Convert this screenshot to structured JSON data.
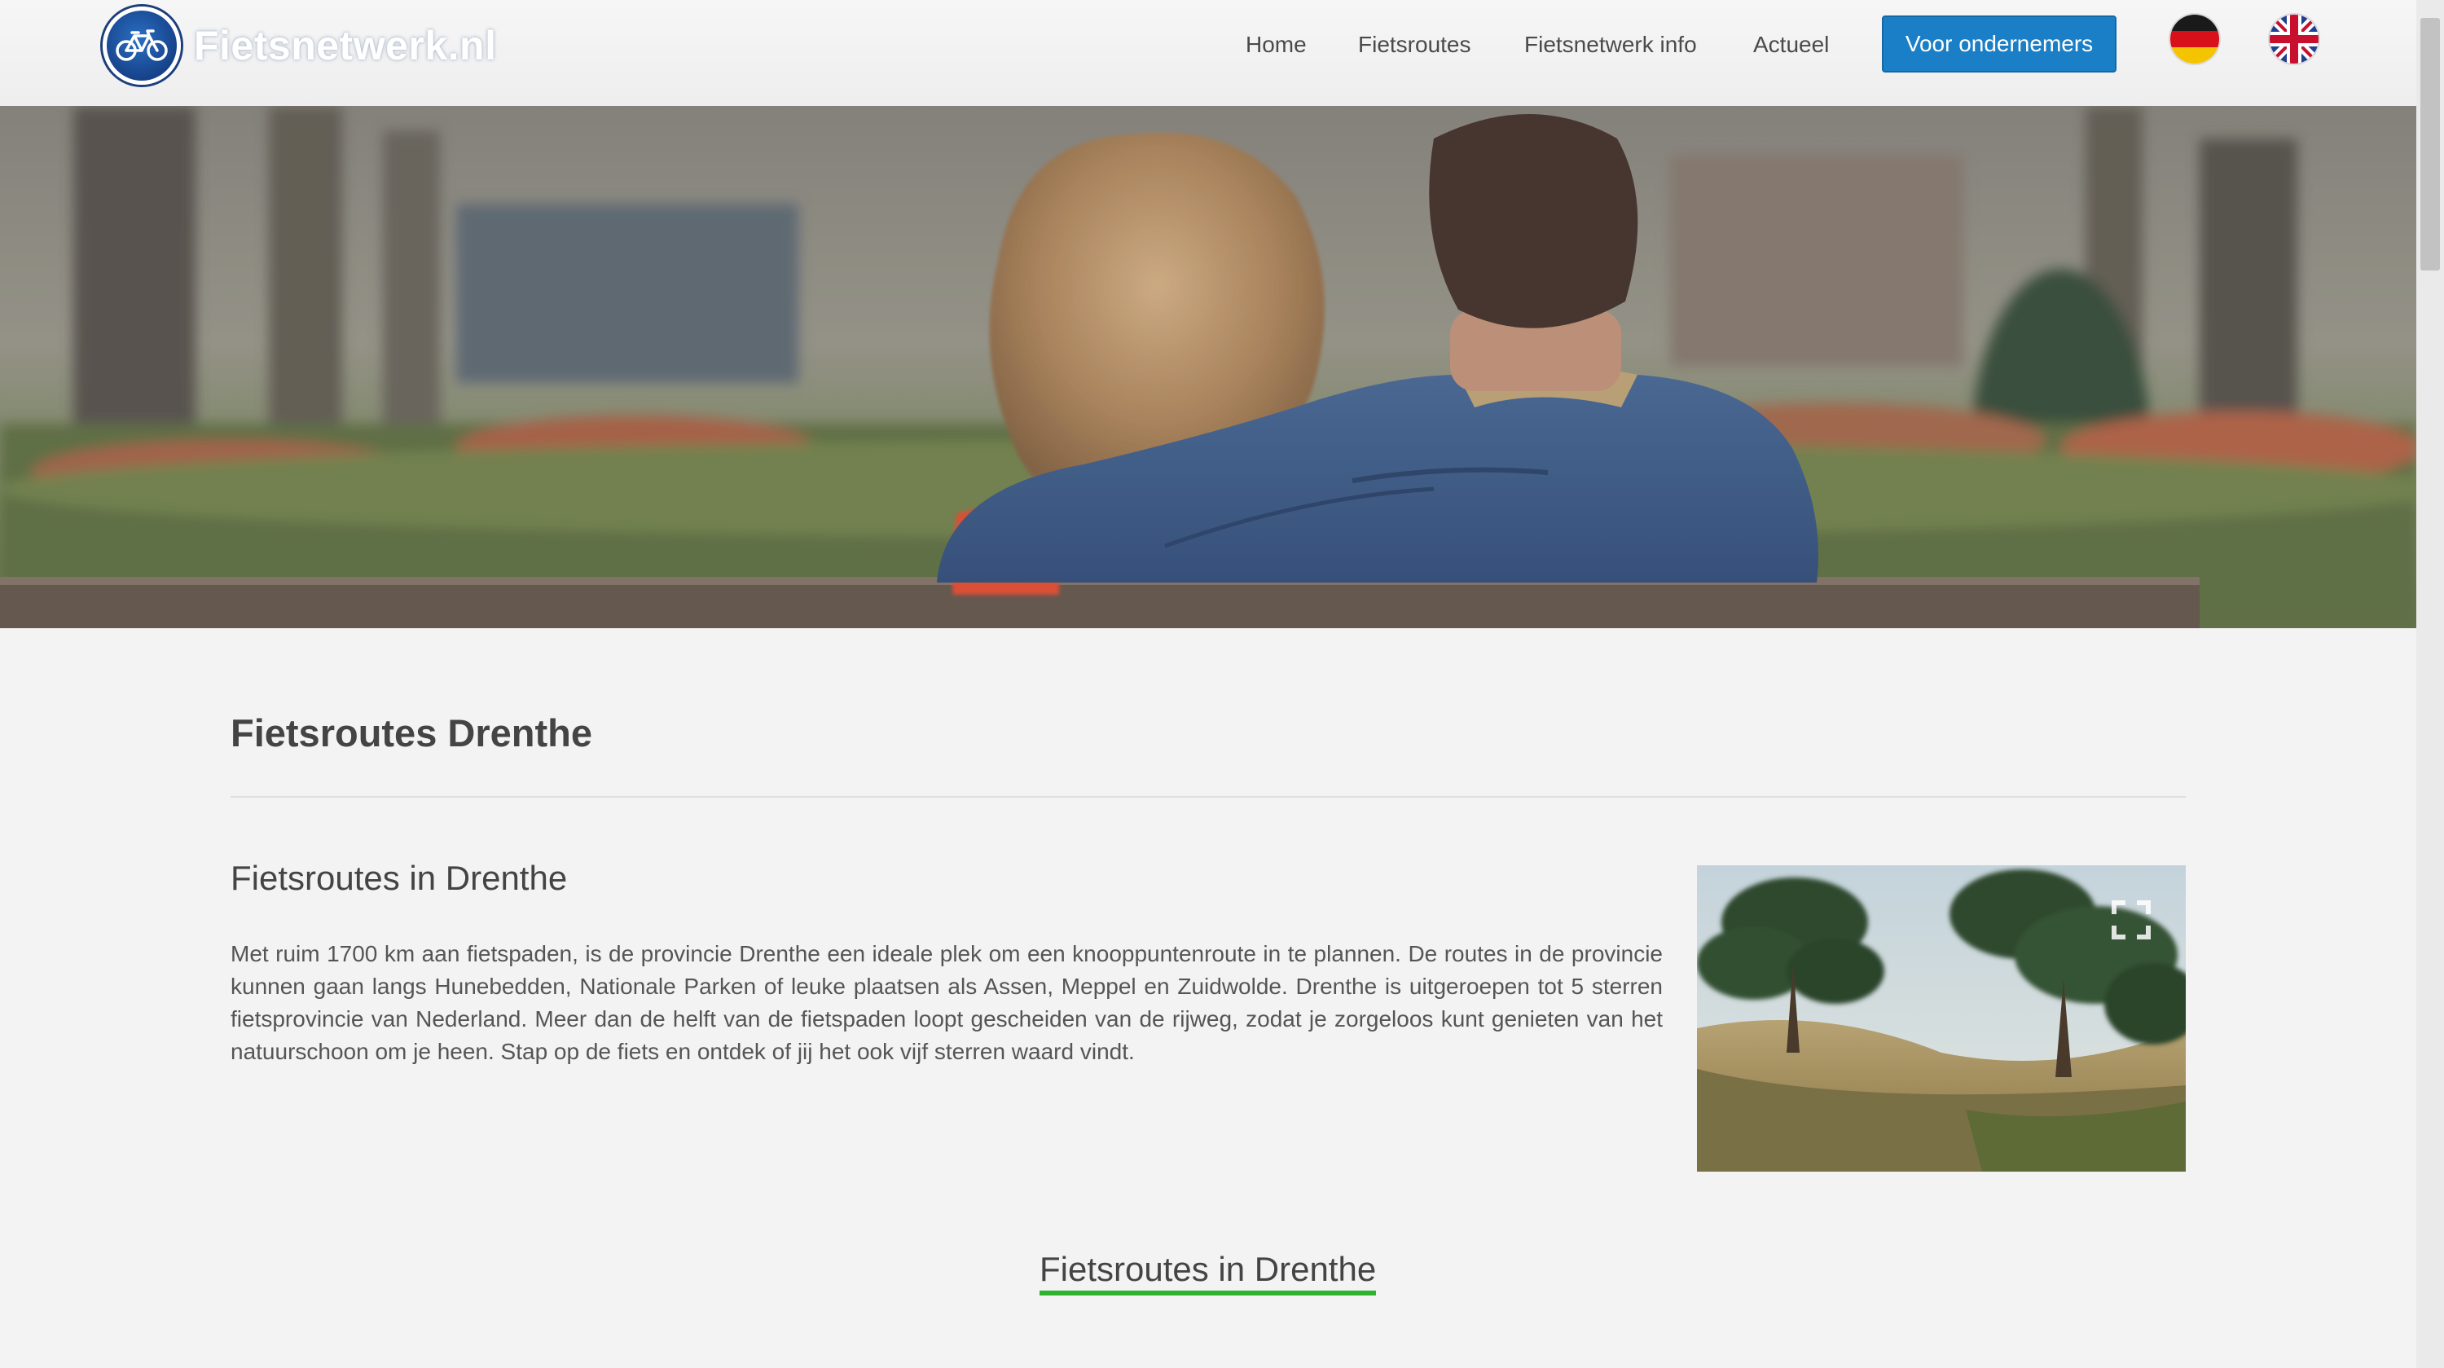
{
  "brand": {
    "logo_text": "Fietsnetwerk.nl"
  },
  "nav": {
    "items": [
      "Home",
      "Fietsroutes",
      "Fietsnetwerk info",
      "Actueel"
    ],
    "cta_label": "Voor ondernemers"
  },
  "languages": [
    "german-flag-icon",
    "uk-flag-icon"
  ],
  "page": {
    "title": "Fietsroutes Drenthe",
    "subtitle": "Fietsroutes in Drenthe",
    "intro": "Met ruim 1700 km aan fietspaden, is de provincie Drenthe een ideale plek om een knooppuntenroute in te plannen. De routes in de provincie kunnen gaan langs Hunebedden, Nationale Parken of leuke plaatsen als Assen, Meppel en Zuidwolde. Drenthe is uitgeroepen tot 5 sterren fietsprovincie van Nederland. Meer dan de helft van de fietspaden loopt gescheiden van de rijweg, zodat je zorgeloos kunt genieten van het natuurschoon om je heen. Stap op de fiets en ontdek of jij het ook vijf sterren waard vindt.",
    "section_heading": "Fietsroutes in Drenthe"
  },
  "colors": {
    "cta": "#1a7fc6",
    "heading_underline": "#2cb52c",
    "background": "#f3f3f3"
  }
}
